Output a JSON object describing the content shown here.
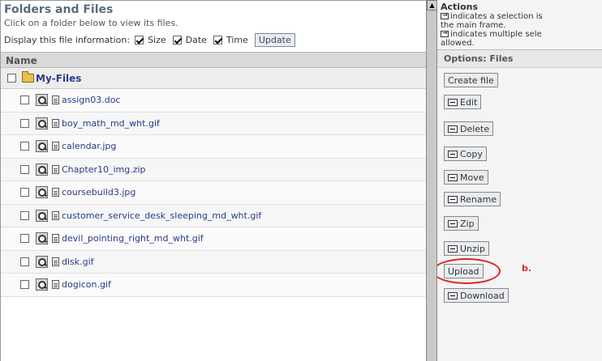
{
  "left": {
    "title": "Folders and Files",
    "subtitle": "Click on a folder below to view its files.",
    "display_label": "Display this file information:",
    "options": [
      {
        "label": "Size",
        "checked": true
      },
      {
        "label": "Date",
        "checked": true
      },
      {
        "label": "Time",
        "checked": true
      }
    ],
    "update_label": "Update",
    "name_header": "Name",
    "folder_name": "My-Files",
    "files": [
      "assign03.doc",
      "boy_math_md_wht.gif",
      "calendar.jpg",
      "Chapter10_img.zip",
      "coursebuild3.jpg",
      "customer_service_desk_sleeping_md_wht.gif",
      "devil_pointing_right_md_wht.gif",
      "disk.gif",
      "dogicon.gif"
    ]
  },
  "right": {
    "actions_title": "Actions",
    "actions_line1": "indicates a selection is",
    "actions_line2": "the main frame.",
    "actions_line3": "indicates multiple sele",
    "actions_line4": "allowed.",
    "options_title": "Options: Files",
    "buttons": {
      "create": "Create file",
      "edit": "Edit",
      "delete": "Delete",
      "copy": "Copy",
      "move": "Move",
      "rename": "Rename",
      "zip": "Zip",
      "unzip": "Unzip",
      "upload": "Upload",
      "download": "Download"
    },
    "annotation": "b."
  },
  "colors": {
    "highlight": "#d9262b",
    "link": "#2a3a8a",
    "title": "#5a6b7d"
  }
}
